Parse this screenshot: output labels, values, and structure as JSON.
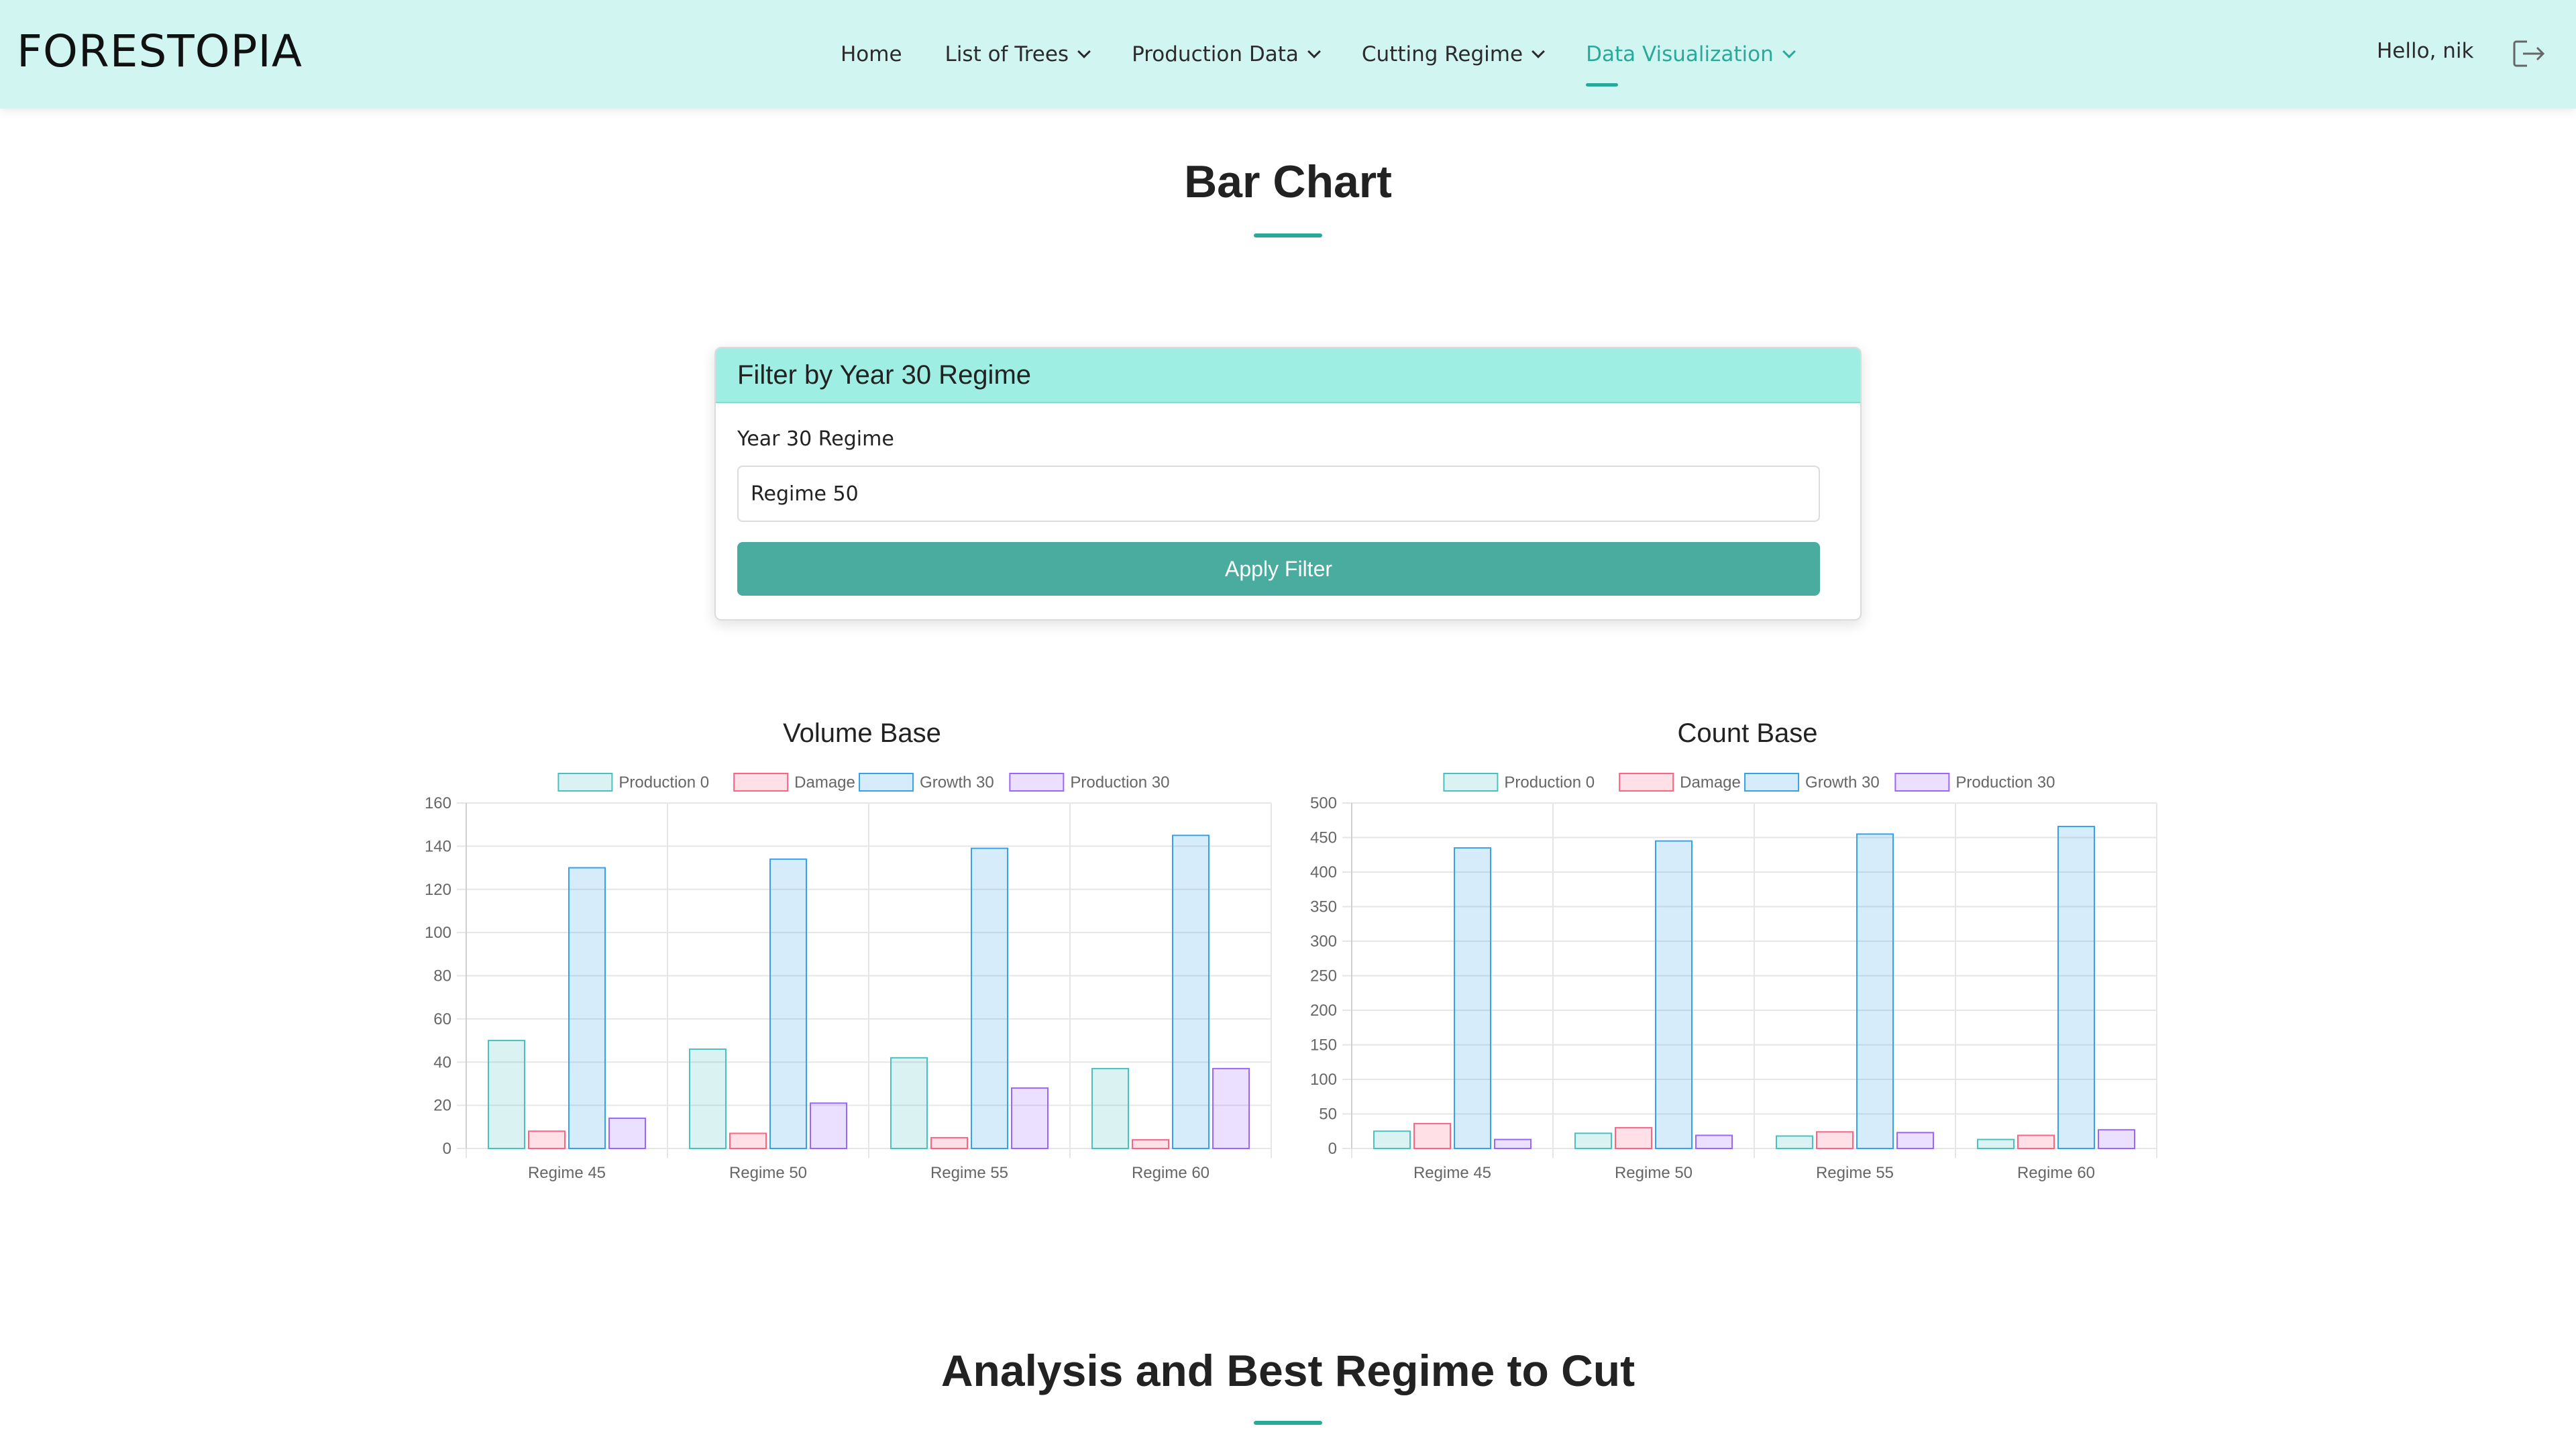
{
  "header": {
    "logo": "FORESTOPIA",
    "nav": [
      {
        "label": "Home",
        "dropdown": false,
        "active": false
      },
      {
        "label": "List of Trees",
        "dropdown": true,
        "active": false
      },
      {
        "label": "Production Data",
        "dropdown": true,
        "active": false
      },
      {
        "label": "Cutting Regime",
        "dropdown": true,
        "active": false
      },
      {
        "label": "Data Visualization",
        "dropdown": true,
        "active": true
      }
    ],
    "greeting": "Hello, nik",
    "logout_icon": "logout-icon"
  },
  "page": {
    "title": "Bar Chart",
    "analysis_title": "Analysis and Best Regime to Cut"
  },
  "filter": {
    "card_title": "Filter by Year 30 Regime",
    "label": "Year 30 Regime",
    "value": "Regime 50",
    "button": "Apply Filter"
  },
  "colors": {
    "accent": "#2aa99a",
    "nav_bg": "#d1f6f1",
    "card_header_bg": "#9eeee3",
    "button_bg": "#4aab9f"
  },
  "chart_data": [
    {
      "type": "bar",
      "title": "Volume Base",
      "categories": [
        "Regime 45",
        "Regime 50",
        "Regime 55",
        "Regime 60"
      ],
      "series": [
        {
          "name": "Production 0",
          "values": [
            50,
            46,
            42,
            37
          ],
          "stroke": "#4bc0c0",
          "fill": "rgba(75,192,192,0.2)"
        },
        {
          "name": "Damage",
          "values": [
            8,
            7,
            5,
            4
          ],
          "stroke": "#ff6384",
          "fill": "rgba(255,99,132,0.2)"
        },
        {
          "name": "Growth 30",
          "values": [
            130,
            134,
            139,
            145
          ],
          "stroke": "#36a2eb",
          "fill": "rgba(54,162,235,0.2)"
        },
        {
          "name": "Production 30",
          "values": [
            14,
            21,
            28,
            37
          ],
          "stroke": "#9966ff",
          "fill": "rgba(153,102,255,0.2)"
        }
      ],
      "ylim": [
        0,
        160
      ],
      "yticks": [
        0,
        20,
        40,
        60,
        80,
        100,
        120,
        140,
        160
      ],
      "legend": "top",
      "grid": true
    },
    {
      "type": "bar",
      "title": "Count Base",
      "categories": [
        "Regime 45",
        "Regime 50",
        "Regime 55",
        "Regime 60"
      ],
      "series": [
        {
          "name": "Production 0",
          "values": [
            25,
            22,
            18,
            13
          ],
          "stroke": "#4bc0c0",
          "fill": "rgba(75,192,192,0.2)"
        },
        {
          "name": "Damage",
          "values": [
            36,
            30,
            24,
            19
          ],
          "stroke": "#ff6384",
          "fill": "rgba(255,99,132,0.2)"
        },
        {
          "name": "Growth 30",
          "values": [
            435,
            445,
            455,
            466
          ],
          "stroke": "#36a2eb",
          "fill": "rgba(54,162,235,0.2)"
        },
        {
          "name": "Production 30",
          "values": [
            13,
            19,
            23,
            27
          ],
          "stroke": "#9966ff",
          "fill": "rgba(153,102,255,0.2)"
        }
      ],
      "ylim": [
        0,
        500
      ],
      "yticks": [
        0,
        50,
        100,
        150,
        200,
        250,
        300,
        350,
        400,
        450,
        500
      ],
      "legend": "top",
      "grid": true
    }
  ]
}
